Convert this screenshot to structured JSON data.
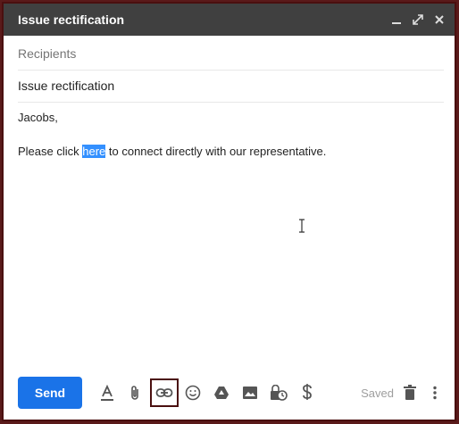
{
  "window": {
    "title": "Issue rectification"
  },
  "titlebar_icons": [
    "minimize-icon",
    "expand-icon",
    "close-icon"
  ],
  "recipients": {
    "placeholder": "Recipients"
  },
  "subject": {
    "value": "Issue rectification"
  },
  "body": {
    "greeting": "Jacobs,",
    "line_before": "Please click ",
    "link_text": "here",
    "line_after": " to connect directly with our representative."
  },
  "toolbar": {
    "send_label": "Send",
    "saved_label": "Saved",
    "tools": [
      "format-text-icon",
      "attach-icon",
      "insert-link-icon",
      "emoji-icon",
      "drive-icon",
      "photo-icon",
      "confidential-icon",
      "money-icon"
    ]
  },
  "colors": {
    "titlebar": "#404040",
    "send": "#1a73e8",
    "highlight": "#3390ff"
  }
}
